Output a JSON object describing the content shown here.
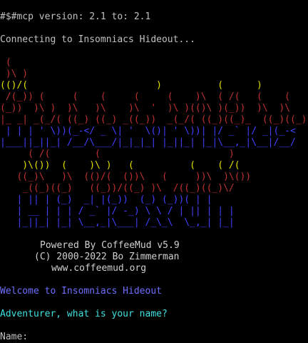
{
  "terminal": {
    "header_line": "#$#mcp version: 2.1 to: 2.1",
    "connecting_line": "Connecting to Insomniacs Hideout...",
    "colors": {
      "background": "#000000",
      "default_text": "#c0c0c0",
      "welcome": "#6f6fff",
      "question": "#40e0e0",
      "art_red": "#c03030",
      "art_yellow": "#e0e000",
      "art_blue": "#4040ff"
    },
    "logo_art": [
      {
        "color": "#c03030",
        "text": " ("
      },
      {
        "color": "#c03030",
        "text": " )\\ )"
      },
      {
        "color": "#e0e000",
        "text": "(()/(                       )          (      )"
      },
      {
        "color": "#c03030",
        "text": " /(_)) (     (    (     (     (    )\\  ( /(   (    ("
      },
      {
        "color": "#c03030",
        "text": "(_))  )\\ )  )\\   )\\    )\\  '  )\\ )(()\\ )(_))  )\\  )\\"
      },
      {
        "color": "#c03030",
        "text": "|_ _| _(_/( ((_) ((_) _((_))  _(_/( ((_)((_)_  ((_)((_)"
      },
      {
        "color": "#4040ff",
        "text": " | | | ' \\))(_-</ _ \\| '  \\()| ' \\))| |/ _` |/ _|(_-<"
      },
      {
        "color": "#4040ff",
        "text": "|___||_||_| /__/\\___/|_|_|_| |_||_| |_|\\__,_|\\__|/__/"
      },
      {
        "color": "#c03030",
        "text": "     ( /(        (                       )"
      },
      {
        "color": "#e0e000",
        "text": "    )\\())  (    )\\ )   (          (    ( /("
      },
      {
        "color": "#c03030",
        "text": "   ((_)\\   )\\  (()/(  ())\\   (     ))\\  )\\())"
      },
      {
        "color": "#c03030",
        "text": "    _((_)((_)   ((_))/((_) )\\  /((_)((_)\\/"
      },
      {
        "color": "#4040ff",
        "text": "   | || | (_)  _| |(_))  (_) (_))( | |"
      },
      {
        "color": "#4040ff",
        "text": "   | __ | | | / _` |/ -_) \\ \\ / | || | | |"
      },
      {
        "color": "#4040ff",
        "text": "   |_||_| |_| \\__,_|\\___| /_\\_\\  \\_,_| |_|"
      }
    ],
    "credits": {
      "powered_by": "Powered By CoffeeMud v5.9",
      "copyright": "(C) 2000-2022 Bo Zimmerman",
      "website": "www.coffeemud.org"
    },
    "welcome_line": "Welcome to Insomniacs Hideout",
    "question_line": "Adventurer, what is your name?",
    "prompt_label": "Name:"
  }
}
